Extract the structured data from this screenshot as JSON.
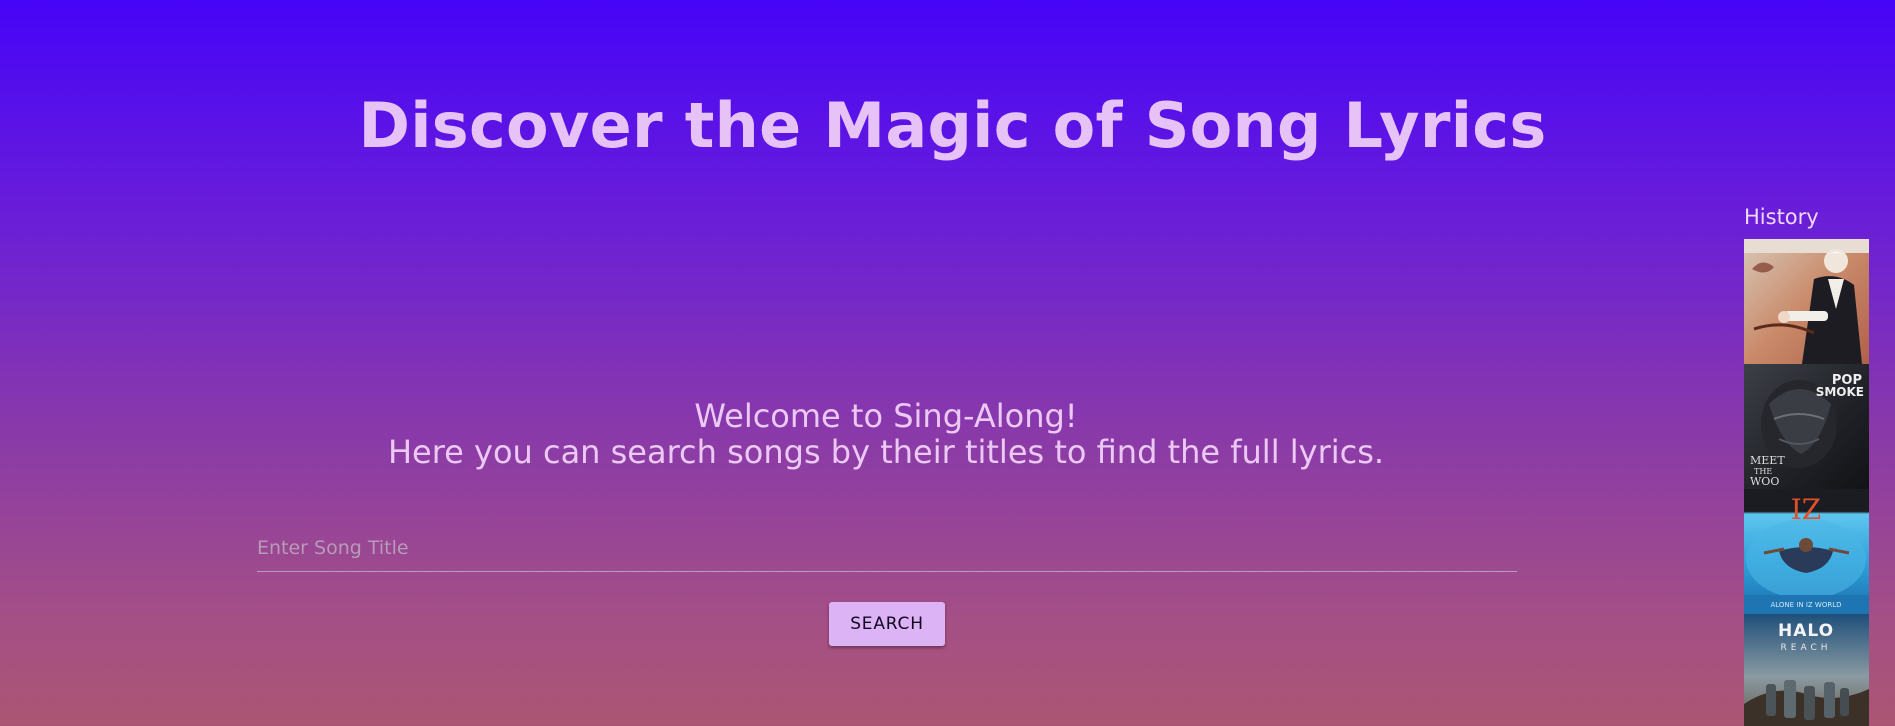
{
  "header": {
    "title": "Discover the Magic of Song Lyrics"
  },
  "welcome": {
    "line1": "Welcome to Sing-Along!",
    "line2": "Here you can search songs by their titles to find the full lyrics."
  },
  "search": {
    "placeholder": "Enter Song Title",
    "value": "",
    "button_label": "SEARCH"
  },
  "history": {
    "title": "History",
    "items": [
      {
        "name": "history-album-1",
        "art": "conductor portrait",
        "accent": "#c9825f"
      },
      {
        "name": "history-album-2",
        "art": "Pop Smoke - Meet the Woo",
        "cover_text": [
          "POP",
          "SMOKE",
          "MEET",
          "THE",
          "WOO"
        ],
        "accent": "#2b2e33"
      },
      {
        "name": "history-album-3",
        "art": "IZ - Alone in IZ World",
        "cover_text": [
          "IZ",
          "ALONE IN IZ WORLD"
        ],
        "accent": "#3aa8dc"
      },
      {
        "name": "history-album-4",
        "art": "Halo Reach",
        "cover_text": [
          "HALO",
          "REACH"
        ],
        "accent": "#7a8a93"
      }
    ]
  }
}
